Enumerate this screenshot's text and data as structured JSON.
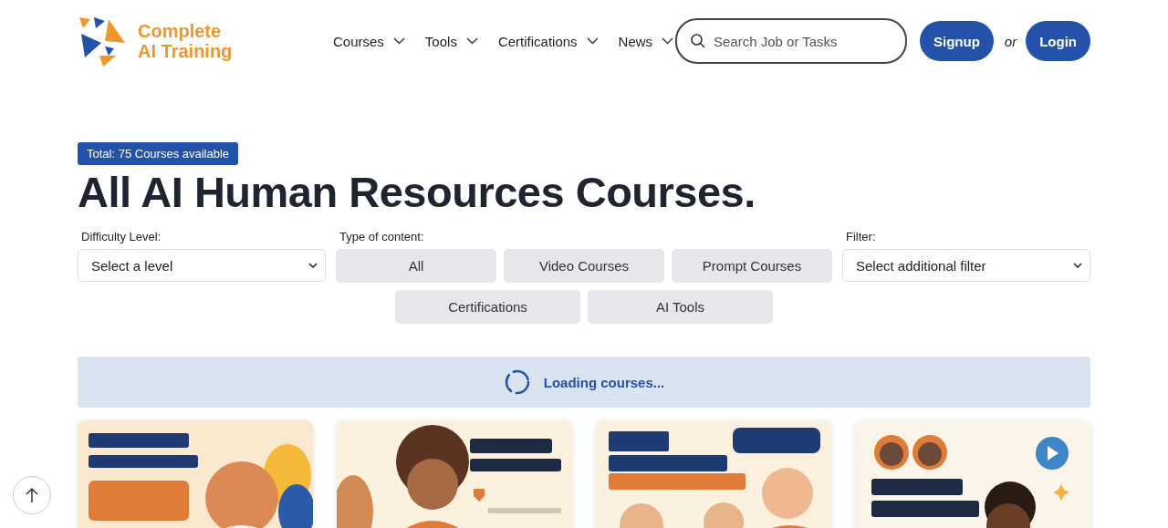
{
  "logo": {
    "line1": "Complete",
    "line2": "AI Training"
  },
  "nav": [
    {
      "label": "Courses"
    },
    {
      "label": "Tools"
    },
    {
      "label": "Certifications"
    },
    {
      "label": "News"
    }
  ],
  "search": {
    "placeholder": "Search Job or Tasks"
  },
  "auth": {
    "signup": "Signup",
    "separator": "or",
    "login": "Login"
  },
  "badge": "Total: 75 Courses available",
  "title": "All AI Human Resources Courses.",
  "filters": {
    "difficulty": {
      "label": "Difficulty Level:",
      "value": "Select a level"
    },
    "content_type": {
      "label": "Type of content:",
      "options": [
        {
          "label": "All",
          "selected": false
        },
        {
          "label": "Video Courses",
          "selected": false
        },
        {
          "label": "Prompt Courses",
          "selected": false
        },
        {
          "label": "Certifications",
          "selected": false
        },
        {
          "label": "AI Tools",
          "selected": false
        }
      ]
    },
    "filter": {
      "label": "Filter:",
      "value": "Select additional filter"
    }
  },
  "loading": {
    "text": "Loading courses..."
  }
}
